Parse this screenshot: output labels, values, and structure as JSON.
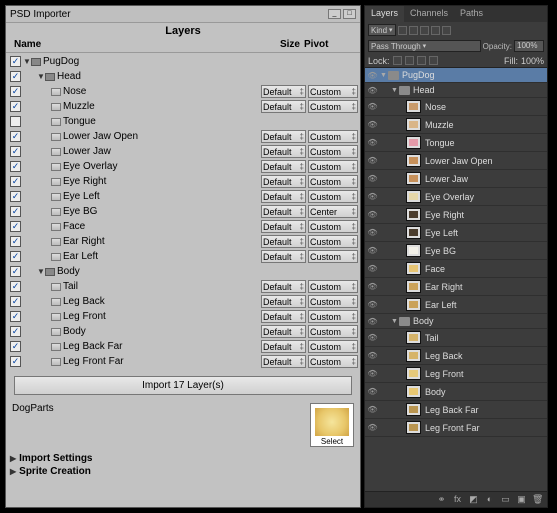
{
  "psd": {
    "title": "PSD Importer",
    "section_label": "Layers",
    "headers": {
      "name": "Name",
      "size": "Size",
      "pivot": "Pivot"
    },
    "root": {
      "name": "PugDog",
      "checked": true
    },
    "head": {
      "name": "Head",
      "checked": true
    },
    "body": {
      "name": "Body",
      "checked": true
    },
    "head_items": [
      {
        "name": "Nose",
        "checked": true,
        "size": "Default",
        "pivot": "Custom"
      },
      {
        "name": "Muzzle",
        "checked": true,
        "size": "Default",
        "pivot": "Custom"
      },
      {
        "name": "Tongue",
        "checked": false,
        "size": "",
        "pivot": ""
      },
      {
        "name": "Lower Jaw Open",
        "checked": true,
        "size": "Default",
        "pivot": "Custom"
      },
      {
        "name": "Lower Jaw",
        "checked": true,
        "size": "Default",
        "pivot": "Custom"
      },
      {
        "name": "Eye Overlay",
        "checked": true,
        "size": "Default",
        "pivot": "Custom"
      },
      {
        "name": "Eye Right",
        "checked": true,
        "size": "Default",
        "pivot": "Custom"
      },
      {
        "name": "Eye Left",
        "checked": true,
        "size": "Default",
        "pivot": "Custom"
      },
      {
        "name": "Eye BG",
        "checked": true,
        "size": "Default",
        "pivot": "Center"
      },
      {
        "name": "Face",
        "checked": true,
        "size": "Default",
        "pivot": "Custom"
      },
      {
        "name": "Ear Right",
        "checked": true,
        "size": "Default",
        "pivot": "Custom"
      },
      {
        "name": "Ear Left",
        "checked": true,
        "size": "Default",
        "pivot": "Custom"
      }
    ],
    "body_items": [
      {
        "name": "Tail",
        "checked": true,
        "size": "Default",
        "pivot": "Custom"
      },
      {
        "name": "Leg Back",
        "checked": true,
        "size": "Default",
        "pivot": "Custom"
      },
      {
        "name": "Leg Front",
        "checked": true,
        "size": "Default",
        "pivot": "Custom"
      },
      {
        "name": "Body",
        "checked": true,
        "size": "Default",
        "pivot": "Custom"
      },
      {
        "name": "Leg Back Far",
        "checked": true,
        "size": "Default",
        "pivot": "Custom"
      },
      {
        "name": "Leg Front Far",
        "checked": true,
        "size": "Default",
        "pivot": "Custom"
      }
    ],
    "import_button": "Import 17 Layer(s)",
    "asset_name": "DogParts",
    "thumb_label": "Select",
    "sections": [
      "Import Settings",
      "Sprite Creation"
    ]
  },
  "ps": {
    "tabs": [
      "Layers",
      "Channels",
      "Paths"
    ],
    "active_tab": "Layers",
    "kind_label": "Kind",
    "blend_mode": "Pass Through",
    "opacity_label": "Opacity:",
    "opacity_value": "100%",
    "lock_label": "Lock:",
    "fill_label": "Fill:",
    "fill_value": "100%",
    "root": {
      "name": "PugDog"
    },
    "head": {
      "name": "Head"
    },
    "body": {
      "name": "Body"
    },
    "head_items": [
      {
        "name": "Nose",
        "sw": "#c89a6a"
      },
      {
        "name": "Muzzle",
        "sw": "#d9b588"
      },
      {
        "name": "Tongue",
        "sw": "#e49aa8"
      },
      {
        "name": "Lower Jaw Open",
        "sw": "#c6905a"
      },
      {
        "name": "Lower Jaw",
        "sw": "#c6905a"
      },
      {
        "name": "Eye Overlay",
        "sw": "#e6d7a8"
      },
      {
        "name": "Eye Right",
        "sw": "#4a3c2c"
      },
      {
        "name": "Eye Left",
        "sw": "#4a3c2c"
      },
      {
        "name": "Eye BG",
        "sw": "#f2f0e8"
      },
      {
        "name": "Face",
        "sw": "#e7c574"
      },
      {
        "name": "Ear Right",
        "sw": "#caa25a"
      },
      {
        "name": "Ear Left",
        "sw": "#caa25a"
      }
    ],
    "body_items": [
      {
        "name": "Tail",
        "sw": "#d6b46a"
      },
      {
        "name": "Leg Back",
        "sw": "#d6b46a"
      },
      {
        "name": "Leg Front",
        "sw": "#e6c97a"
      },
      {
        "name": "Body",
        "sw": "#e9c872"
      },
      {
        "name": "Leg Back Far",
        "sw": "#b99550"
      },
      {
        "name": "Leg Front Far",
        "sw": "#b99550"
      }
    ]
  }
}
